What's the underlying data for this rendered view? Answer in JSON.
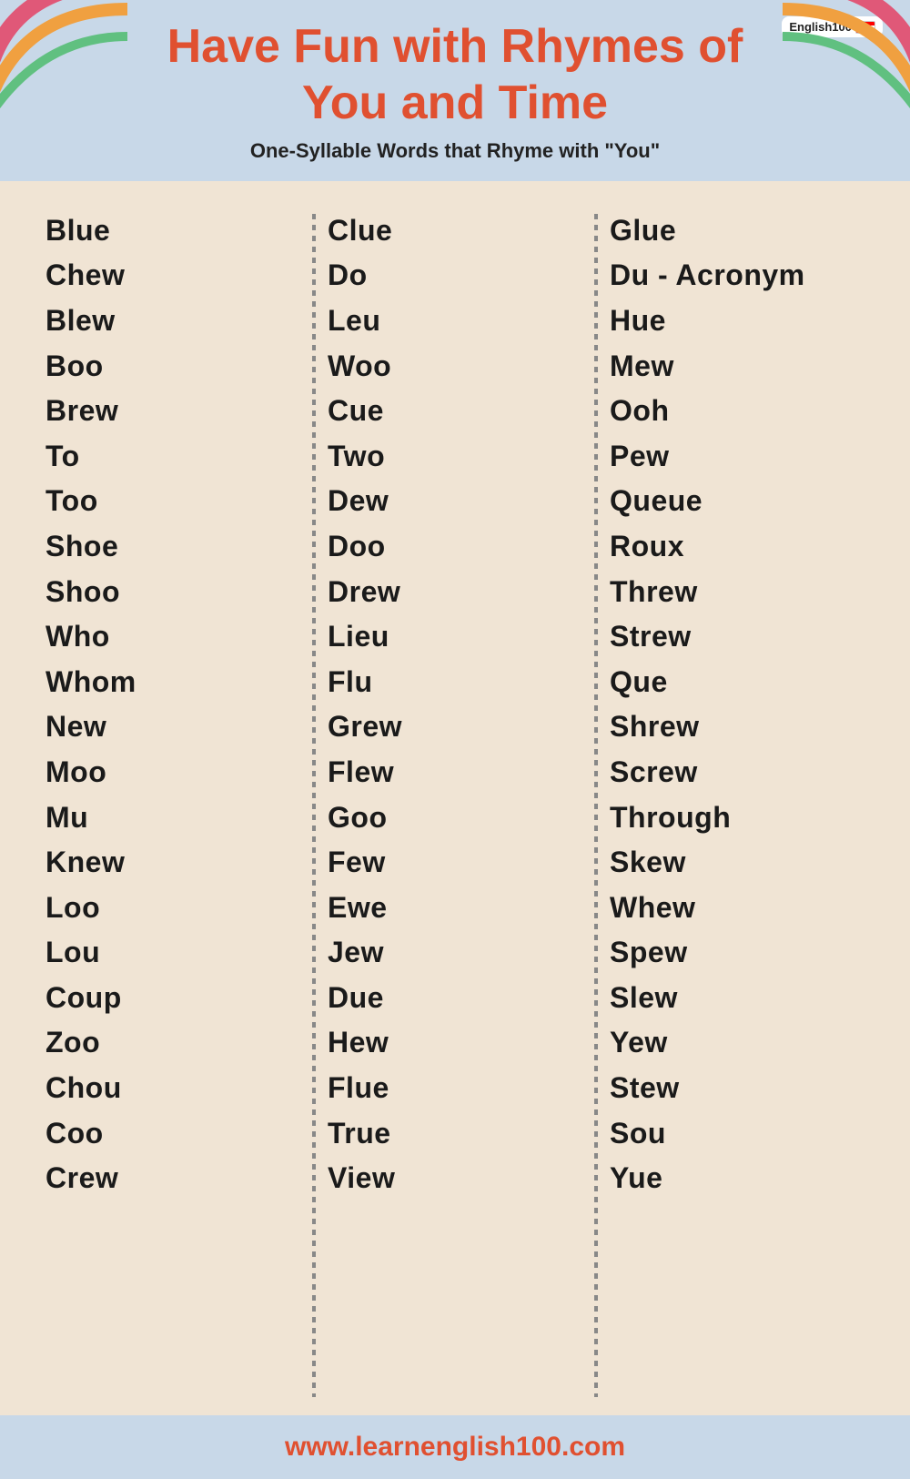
{
  "brand": {
    "text": "English100",
    "url": "www.learnenglish100.com"
  },
  "header": {
    "title_line1": "Have Fun with Rhymes of",
    "title_line2": "You and Time",
    "subtitle": "One-Syllable Words that Rhyme with \"You\""
  },
  "columns": {
    "col1": [
      "Blue",
      "Chew",
      "Blew",
      "Boo",
      "Brew",
      "To",
      "Too",
      "Shoe",
      "Shoo",
      "Who",
      "Whom",
      "New",
      "Moo",
      "Mu",
      "Knew",
      "Loo",
      "Lou",
      "Coup",
      "Zoo",
      "Chou",
      "Coo",
      "Crew"
    ],
    "col2": [
      "Clue",
      "Do",
      "Leu",
      "Woo",
      "Cue",
      "Two",
      "Dew",
      "Doo",
      "Drew",
      "Lieu",
      "Flu",
      "Grew",
      "Flew",
      "Goo",
      "Few",
      "Ewe",
      "Jew",
      "Due",
      "Hew",
      "Flue",
      "True",
      "View"
    ],
    "col3": [
      "Glue",
      "Du - Acronym",
      "Hue",
      "Mew",
      "Ooh",
      "Pew",
      "Queue",
      "Roux",
      "Threw",
      "Strew",
      "Que",
      "Shrew",
      "Screw",
      "Through",
      "Skew",
      "Whew",
      "Spew",
      "Slew",
      "Yew",
      "Stew",
      "Sou",
      "Yue"
    ]
  }
}
